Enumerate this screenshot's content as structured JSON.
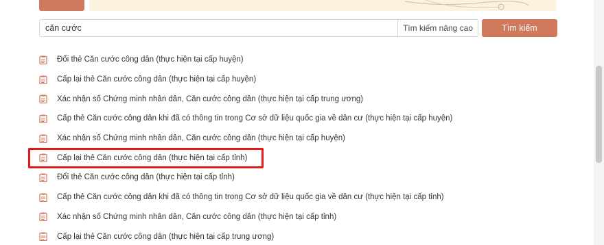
{
  "search": {
    "value": "căn cước",
    "advanced_label": "Tìm kiếm nâng cao",
    "button_label": "Tìm kiếm"
  },
  "results": [
    {
      "label": "Đổi thẻ Căn cước công dân (thực hiện tại cấp huyện)"
    },
    {
      "label": "Cấp lại thẻ Căn cước công dân (thực hiện tại cấp huyện)"
    },
    {
      "label": "Xác nhận số Chứng minh nhân dân, Căn cước công dân (thực hiện tại cấp trung ương)"
    },
    {
      "label": "Cấp thẻ Căn cước công dân khi đã có thông tin trong Cơ sở dữ liệu quốc gia về dân cư (thực hiện tại cấp huyện)"
    },
    {
      "label": "Xác nhận số Chứng minh nhân dân, Căn cước công dân (thực hiện tại cấp huyện)"
    },
    {
      "label": "Cấp lại thẻ Căn cước công dân (thực hiện tại cấp tỉnh)"
    },
    {
      "label": "Đổi thẻ Căn cước công dân (thực hiện tại cấp tỉnh)"
    },
    {
      "label": "Cấp thẻ Căn cước công dân khi đã có thông tin trong Cơ sở dữ liệu quốc gia về dân cư (thực hiện tại cấp tỉnh)"
    },
    {
      "label": "Xác nhận số Chứng minh nhân dân, Căn cước công dân (thực hiện tại cấp tỉnh)"
    },
    {
      "label": "Cấp lại thẻ Căn cước công dân (thực hiện tại cấp trung ương)"
    }
  ],
  "icons": {
    "result_icon": "document-icon"
  },
  "colors": {
    "accent": "#d0795c",
    "highlight": "#e01b1b",
    "banner": "#fbf3de"
  }
}
